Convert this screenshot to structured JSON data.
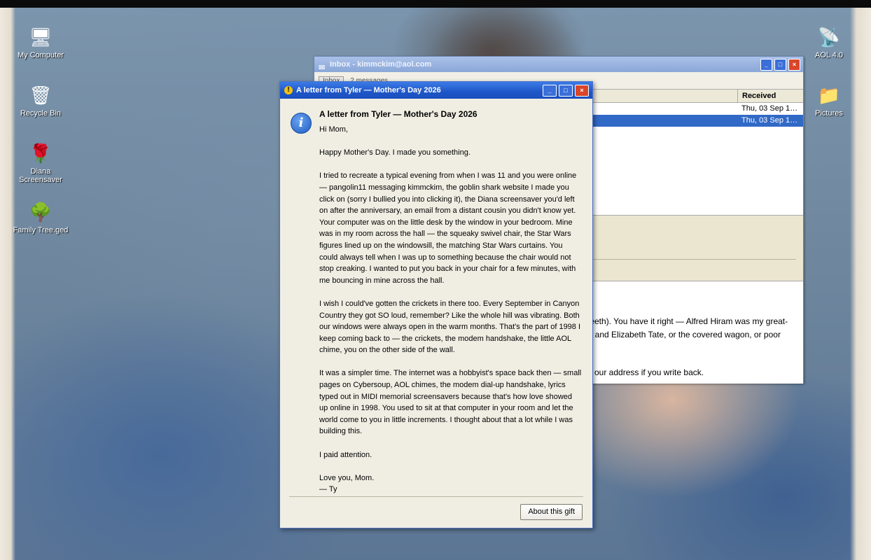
{
  "desktop": {
    "icons_left": [
      {
        "label": "My Computer",
        "icon": "computer-icon",
        "glyph": "🖥"
      },
      {
        "label": "Recycle Bin",
        "icon": "recycle-bin-icon",
        "glyph": "🗑"
      },
      {
        "label": "Diana Screensaver",
        "icon": "rose-icon",
        "glyph": "🌹"
      },
      {
        "label": "Family Tree.ged",
        "icon": "tree-icon",
        "glyph": "🌳"
      }
    ],
    "icons_right": [
      {
        "label": "AOL 4.0",
        "icon": "satellite-dish-icon",
        "glyph": "📡"
      },
      {
        "label": "Pictures",
        "icon": "folder-icon",
        "glyph": "📁"
      }
    ]
  },
  "inbox_window": {
    "title": "Inbox - kimmckim@aol.com",
    "tab_label": "Inbox",
    "message_count": "2 messages",
    "columns": {
      "received": "Received"
    },
    "rows": [
      {
        "received": "Thu, 03 Sep 1…",
        "selected": false
      },
      {
        "received": "Thu, 03 Sep 1…",
        "selected": true
      }
    ],
    "body_lines": [
      "teeth). You have it right — Alfred Hiram was my great-",
      "rt and Elizabeth Tate, or the covered wagon, or poor",
      "u our address if you write back."
    ]
  },
  "letter_dialog": {
    "title": "A letter from Tyler — Mother's Day 2026",
    "heading": "A letter from Tyler — Mother's Day 2026",
    "greeting": "Hi Mom,",
    "paragraphs": [
      "Happy Mother's Day. I made you something.",
      "I tried to recreate a typical evening from when I was 11 and you were online — pangolin11 messaging kimmckim, the goblin shark website I made you click on (sorry I bullied you into clicking it), the Diana screensaver you'd left on after the anniversary, an email from a distant cousin you didn't know yet. Your computer was on the little desk by the window in your bedroom. Mine was in my room across the hall — the squeaky swivel chair, the Star Wars figures lined up on the windowsill, the matching Star Wars curtains. You could always tell when I was up to something because the chair would not stop creaking. I wanted to put you back in your chair for a few minutes, with me bouncing in mine across the hall.",
      "I wish I could've gotten the crickets in there too. Every September in Canyon Country they got SO loud, remember? Like the whole hill was vibrating. Both our windows were always open in the warm months. That's the part of 1998 I keep coming back to — the crickets, the modem handshake, the little AOL chime, you on the other side of the wall.",
      "It was a simpler time. The internet was a hobbyist's space back then — small pages on Cybersoup, AOL chimes, the modem dial-up handshake, lyrics typed out in MIDI memorial screensavers because that's how love showed up online in 1998. You used to sit at that computer in your room and let the world come to you in little increments. I thought about that a lot while I was building this.",
      "I paid attention."
    ],
    "signoff": "Love you, Mom.",
    "signature": "— Ty",
    "about_button": "About this gift",
    "window_buttons": {
      "minimize": "_",
      "maximize": "□",
      "close": "×"
    }
  },
  "colors": {
    "xp_titlebar": "#1e56c8",
    "inactive_titlebar": "#8aa7d8",
    "selection": "#3169c6",
    "dialog_bg": "#f0eee3"
  }
}
